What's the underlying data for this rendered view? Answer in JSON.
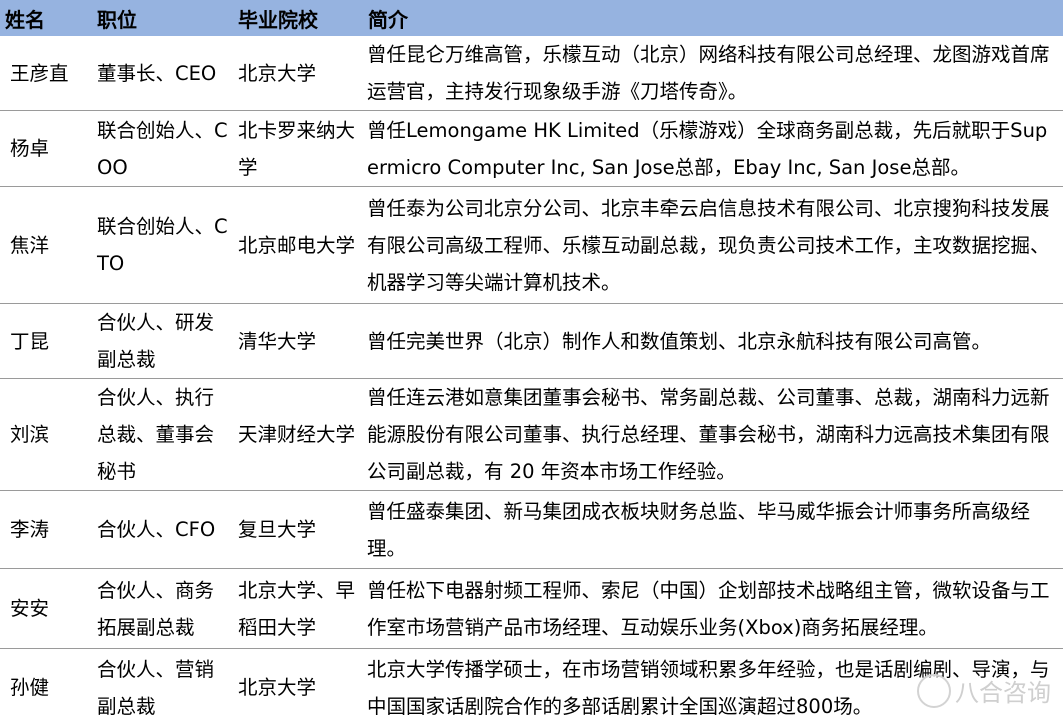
{
  "header": {
    "name": "姓名",
    "position": "职位",
    "school": "毕业院校",
    "bio": "简介"
  },
  "rows": [
    {
      "name": "王彦直",
      "position": "董事长、CEO",
      "school": "北京大学",
      "bio": "曾任昆仑万维高管，乐檬互动（北京）网络科技有限公司总经理、龙图游戏首席运营官，主持发行现象级手游《刀塔传奇》。"
    },
    {
      "name": "杨卓",
      "position": "联合创始人、COO",
      "school": "北卡罗来纳大学",
      "bio": "曾任Lemongame HK Limited（乐檬游戏）全球商务副总裁，先后就职于Supermicro Computer Inc, San Jose总部，Ebay Inc, San Jose总部。"
    },
    {
      "name": "焦洋",
      "position": "联合创始人、CTO",
      "school": "北京邮电大学",
      "bio": "曾任泰为公司北京分公司、北京丰牵云启信息技术有限公司、北京搜狗科技发展有限公司高级工程师、乐檬互动副总裁，现负责公司技术工作，主攻数据挖掘、机器学习等尖端计算机技术。"
    },
    {
      "name": "丁昆",
      "position": "合伙人、研发副总裁",
      "school": "清华大学",
      "bio": "曾任完美世界（北京）制作人和数值策划、北京永航科技有限公司高管。"
    },
    {
      "name": "刘滨",
      "position": "合伙人、执行总裁、董事会秘书",
      "school": "天津财经大学",
      "bio": "曾任连云港如意集团董事会秘书、常务副总裁、公司董事、总裁，湖南科力远新能源股份有限公司董事、执行总经理、董事会秘书，湖南科力远高技术集团有限公司副总裁，有 20 年资本市场工作经验。"
    },
    {
      "name": "李涛",
      "position": "合伙人、CFO",
      "school": "复旦大学",
      "bio": "曾任盛泰集团、新马集团成衣板块财务总监、毕马威华振会计师事务所高级经理。"
    },
    {
      "name": "安安",
      "position": "合伙人、商务拓展副总裁",
      "school": "北京大学、早稻田大学",
      "bio": "曾任松下电器射频工程师、索尼（中国）企划部技术战略组主管，微软设备与工作室市场营销产品市场经理、互动娱乐业务(Xbox)商务拓展经理。"
    },
    {
      "name": "孙健",
      "position": "合伙人、营销副总裁",
      "school": "北京大学",
      "bio": "北京大学传播学硕士，在市场营销领域积累多年经验，也是话剧编剧、导演，与中国国家话剧院合作的多部话剧累计全国巡演超过800场。"
    }
  ],
  "watermark": {
    "icon": "wechat-logo-icon",
    "text": "八合咨询"
  }
}
